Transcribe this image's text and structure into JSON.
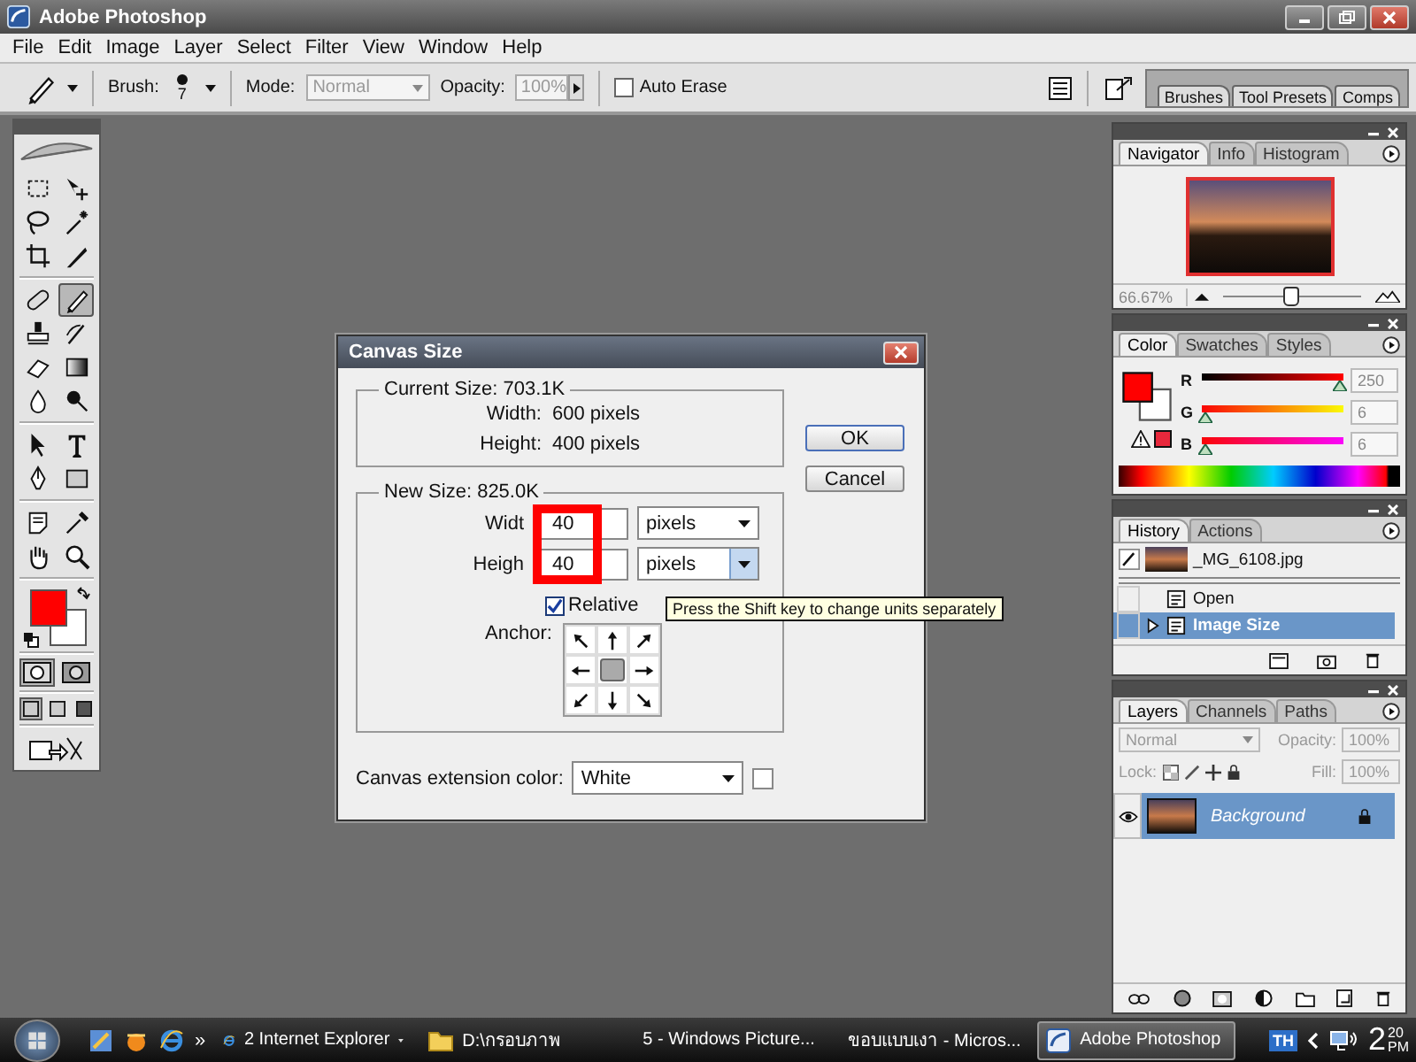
{
  "window": {
    "title": "Adobe Photoshop"
  },
  "menu": [
    "File",
    "Edit",
    "Image",
    "Layer",
    "Select",
    "Filter",
    "View",
    "Window",
    "Help"
  ],
  "options_bar": {
    "brush_label": "Brush:",
    "brush_size": "7",
    "mode_label": "Mode:",
    "mode": {
      "value": "Normal",
      "disabled": true
    },
    "opacity_label": "Opacity:",
    "opacity": {
      "value": "100%",
      "disabled": true
    },
    "auto_erase": {
      "label": "Auto Erase",
      "checked": false
    },
    "palette_tabs": [
      {
        "label": "Brushes"
      },
      {
        "label": "Tool Presets"
      },
      {
        "label": "Comps"
      }
    ]
  },
  "toolbox": {
    "tools": [
      {
        "selected": false
      },
      {
        "selected": false
      },
      {
        "selected": false
      },
      {
        "selected": false
      },
      {
        "selected": false
      },
      {
        "selected": false
      },
      {
        "selected": false
      },
      {
        "selected": true
      },
      {
        "selected": false
      },
      {
        "selected": false
      },
      {
        "selected": false
      },
      {
        "selected": false
      },
      {
        "selected": false
      },
      {
        "selected": false
      },
      {
        "selected": false
      },
      {
        "selected": false
      },
      {
        "selected": false
      },
      {
        "selected": false
      },
      {
        "selected": false
      },
      {
        "selected": false
      },
      {
        "selected": false
      },
      {
        "selected": false
      }
    ],
    "swatches": [
      {
        "color": "#ff0000"
      },
      {
        "color": "#ffffff"
      }
    ],
    "mask_modes": [
      {
        "selected": true
      },
      {
        "selected": false
      }
    ],
    "screen_modes": [
      {
        "selected": true
      },
      {
        "selected": false
      },
      {
        "selected": false
      }
    ]
  },
  "dialog": {
    "title": "Canvas Size",
    "current": {
      "legend": "Current Size: 703.1K",
      "rows": [
        {
          "label": "Width:",
          "value": "600 pixels"
        },
        {
          "label": "Height:",
          "value": "400 pixels"
        }
      ]
    },
    "new_size": {
      "legend": "New Size: 825.0K",
      "fields": [
        {
          "label": "Widt",
          "value": "40",
          "unit": "pixels",
          "hovered": false
        },
        {
          "label": "Heigh",
          "value": "40",
          "unit": "pixels",
          "hovered": true
        }
      ],
      "relative": {
        "label": "Relative",
        "checked": true
      },
      "anchor_label": "Anchor:",
      "anchor": [
        {
          "selected": false
        },
        {
          "selected": false
        },
        {
          "selected": false
        },
        {
          "selected": false
        },
        {
          "selected": true
        },
        {
          "selected": false
        },
        {
          "selected": false
        },
        {
          "selected": false
        },
        {
          "selected": false
        }
      ]
    },
    "extension": {
      "label": "Canvas extension color:",
      "value": "White"
    },
    "buttons": [
      {
        "label": "OK",
        "default": true
      },
      {
        "label": "Cancel",
        "default": false
      }
    ]
  },
  "tooltip": "Press the Shift key to change units separately",
  "navigator": {
    "tabs": [
      {
        "label": "Navigator",
        "selected": true
      },
      {
        "label": "Info",
        "selected": false
      },
      {
        "label": "Histogram",
        "selected": false
      }
    ],
    "zoom": "66.67%",
    "level": 0.48
  },
  "color_panel": {
    "tabs": [
      {
        "label": "Color",
        "selected": true
      },
      {
        "label": "Swatches",
        "selected": false
      },
      {
        "label": "Styles",
        "selected": false
      }
    ],
    "channels": [
      {
        "name": "R",
        "value": "250",
        "level": 0.98
      },
      {
        "name": "G",
        "value": "6",
        "level": 0.02
      },
      {
        "name": "B",
        "value": "6",
        "level": 0.02
      }
    ]
  },
  "history": {
    "tabs": [
      {
        "label": "History",
        "selected": true
      },
      {
        "label": "Actions",
        "selected": false
      }
    ],
    "snapshot": "_MG_6108.jpg",
    "steps": [
      {
        "label": "Open",
        "selected": false
      },
      {
        "label": "Image Size",
        "selected": true
      }
    ]
  },
  "layers": {
    "tabs": [
      {
        "label": "Layers",
        "selected": true
      },
      {
        "label": "Channels",
        "selected": false
      },
      {
        "label": "Paths",
        "selected": false
      }
    ],
    "blend_mode": "Normal",
    "opacity_label": "Opacity:",
    "opacity": "100%",
    "lock_label": "Lock:",
    "fill_label": "Fill:",
    "fill": "100%",
    "controls_disabled": true,
    "items": [
      {
        "name": "Background",
        "selected": true,
        "visible": true,
        "locked": true
      }
    ]
  },
  "taskbar": {
    "more": "»",
    "items": [
      {
        "label": "2 Internet Explorer",
        "kind": "browser",
        "selected": false
      },
      {
        "label": "D:\\กรอบภาพ",
        "kind": "folder",
        "selected": false
      },
      {
        "label": "5 - Windows Picture...",
        "kind": "picture",
        "selected": false
      },
      {
        "label": "ขอบแบบเงา - Micros...",
        "kind": "document",
        "selected": false
      },
      {
        "label": "Adobe Photoshop",
        "kind": "photoshop",
        "selected": true
      }
    ],
    "language": "TH",
    "clock": {
      "hour": "2",
      "minutes": "20",
      "ampm": "PM"
    }
  }
}
